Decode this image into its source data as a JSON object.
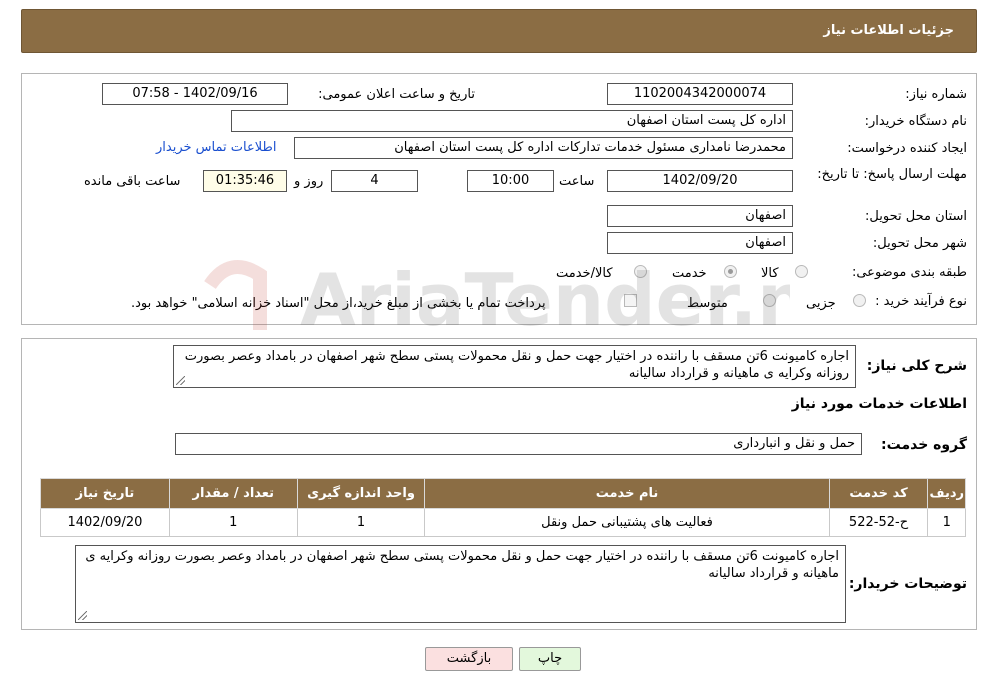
{
  "header": {
    "title": "جزئیات اطلاعات نیاز"
  },
  "form": {
    "need_number": {
      "label": "شماره نیاز:",
      "value": "1102004342000074"
    },
    "announce_datetime": {
      "label": "تاریخ و ساعت اعلان عمومی:",
      "value": "1402/09/16 - 07:58"
    },
    "buyer_org": {
      "label": "نام دستگاه خریدار:",
      "value": "اداره کل پست استان اصفهان"
    },
    "requester": {
      "label": "ایجاد کننده درخواست:",
      "value": "محمدرضا نامداری مسئول خدمات تدارکات اداره کل پست استان اصفهان"
    },
    "contact_link": "اطلاعات تماس خریدار",
    "deadline": {
      "label": "مهلت ارسال پاسخ: تا تاریخ:",
      "date": "1402/09/20",
      "time_label": "ساعت",
      "time": "10:00",
      "days": "4",
      "days_label": "روز و",
      "remaining": "01:35:46",
      "remaining_label": "ساعت باقی مانده"
    },
    "delivery_province": {
      "label": "استان محل تحویل:",
      "value": "اصفهان"
    },
    "delivery_city": {
      "label": "شهر محل تحویل:",
      "value": "اصفهان"
    },
    "category": {
      "label": "طبقه بندی موضوعی:",
      "options": [
        "کالا",
        "خدمت",
        "کالا/خدمت"
      ],
      "selected": "خدمت"
    },
    "purchase_type": {
      "label": "نوع فرآیند خرید :",
      "options": [
        "جزیی",
        "متوسط"
      ],
      "payment_note": "پرداخت تمام یا بخشی از مبلغ خرید،از محل \"اسناد خزانه اسلامی\" خواهد بود."
    }
  },
  "description": {
    "label": "شرح کلی نیاز:",
    "value": "اجاره کامیونت 6تن مسقف با راننده در اختیار جهت حمل و نقل محمولات پستی سطح شهر اصفهان در بامداد وعصر  بصورت روزانه وکرایه ی ماهیانه و قرارداد سالیانه"
  },
  "services_section": {
    "title": "اطلاعات خدمات مورد نیاز",
    "service_group_label": "گروه خدمت:",
    "service_group_value": "حمل و نقل و انبارداری"
  },
  "table": {
    "headers": [
      "ردیف",
      "کد خدمت",
      "نام خدمت",
      "واحد اندازه گیری",
      "تعداد / مقدار",
      "تاریخ نیاز"
    ],
    "rows": [
      [
        "1",
        "ح-52-522",
        "فعالیت های پشتیبانی حمل ونقل",
        "1",
        "1",
        "1402/09/20"
      ]
    ]
  },
  "buyer_notes": {
    "label": "توضیحات خریدار:",
    "value": "اجاره کامیونت 6تن مسقف با راننده در اختیار جهت حمل و نقل محمولات پستی سطح شهر اصفهان در بامداد وعصر  بصورت روزانه وکرایه ی ماهیانه و قرارداد سالیانه"
  },
  "buttons": {
    "print": "چاپ",
    "back": "بازگشت"
  },
  "watermark": {
    "text": "AriaTender.net"
  },
  "colors": {
    "header_bg": "#8b6d44",
    "link": "#1a4fcf",
    "print_btn": "#e3f8dc",
    "back_btn": "#fbe0e0"
  }
}
